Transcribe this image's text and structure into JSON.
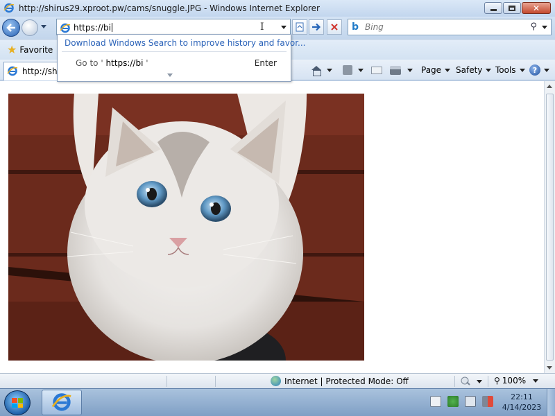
{
  "window": {
    "title": "http://shirus29.xproot.pw/cams/snuggle.JPG - Windows Internet Explorer"
  },
  "address_bar": {
    "value": "https://bi"
  },
  "search": {
    "placeholder": "Bing"
  },
  "autocomplete": {
    "windows_search_link": "Download Windows Search to improve history and favor...",
    "goto_prefix": "Go to '",
    "goto_url": "https://bi",
    "goto_suffix": "'",
    "enter_label": "Enter"
  },
  "favorites_bar": {
    "label": "Favorite"
  },
  "tab": {
    "label": "http://shi"
  },
  "command_bar": {
    "page_label": "Page",
    "safety_label": "Safety",
    "tools_label": "Tools"
  },
  "status_bar": {
    "zone_text": "Internet | Protected Mode: Off",
    "zoom": "100%"
  },
  "taskbar": {
    "time": "22:11",
    "date": "4/14/2023"
  },
  "colors": {
    "accent": "#2a62b8",
    "titlebar": "#c2d6ee",
    "close_button": "#c44a2f",
    "taskbar": "#7f9fc5"
  },
  "icons": [
    "ie-icon",
    "back-icon",
    "forward-icon",
    "compatibility-view-icon",
    "go-arrow-icon",
    "stop-icon",
    "bing-icon",
    "search-icon",
    "star-icon",
    "home-icon",
    "rss-icon",
    "read-mail-icon",
    "print-icon",
    "help-icon",
    "globe-icon",
    "zoom-icon",
    "windows-logo-icon"
  ]
}
